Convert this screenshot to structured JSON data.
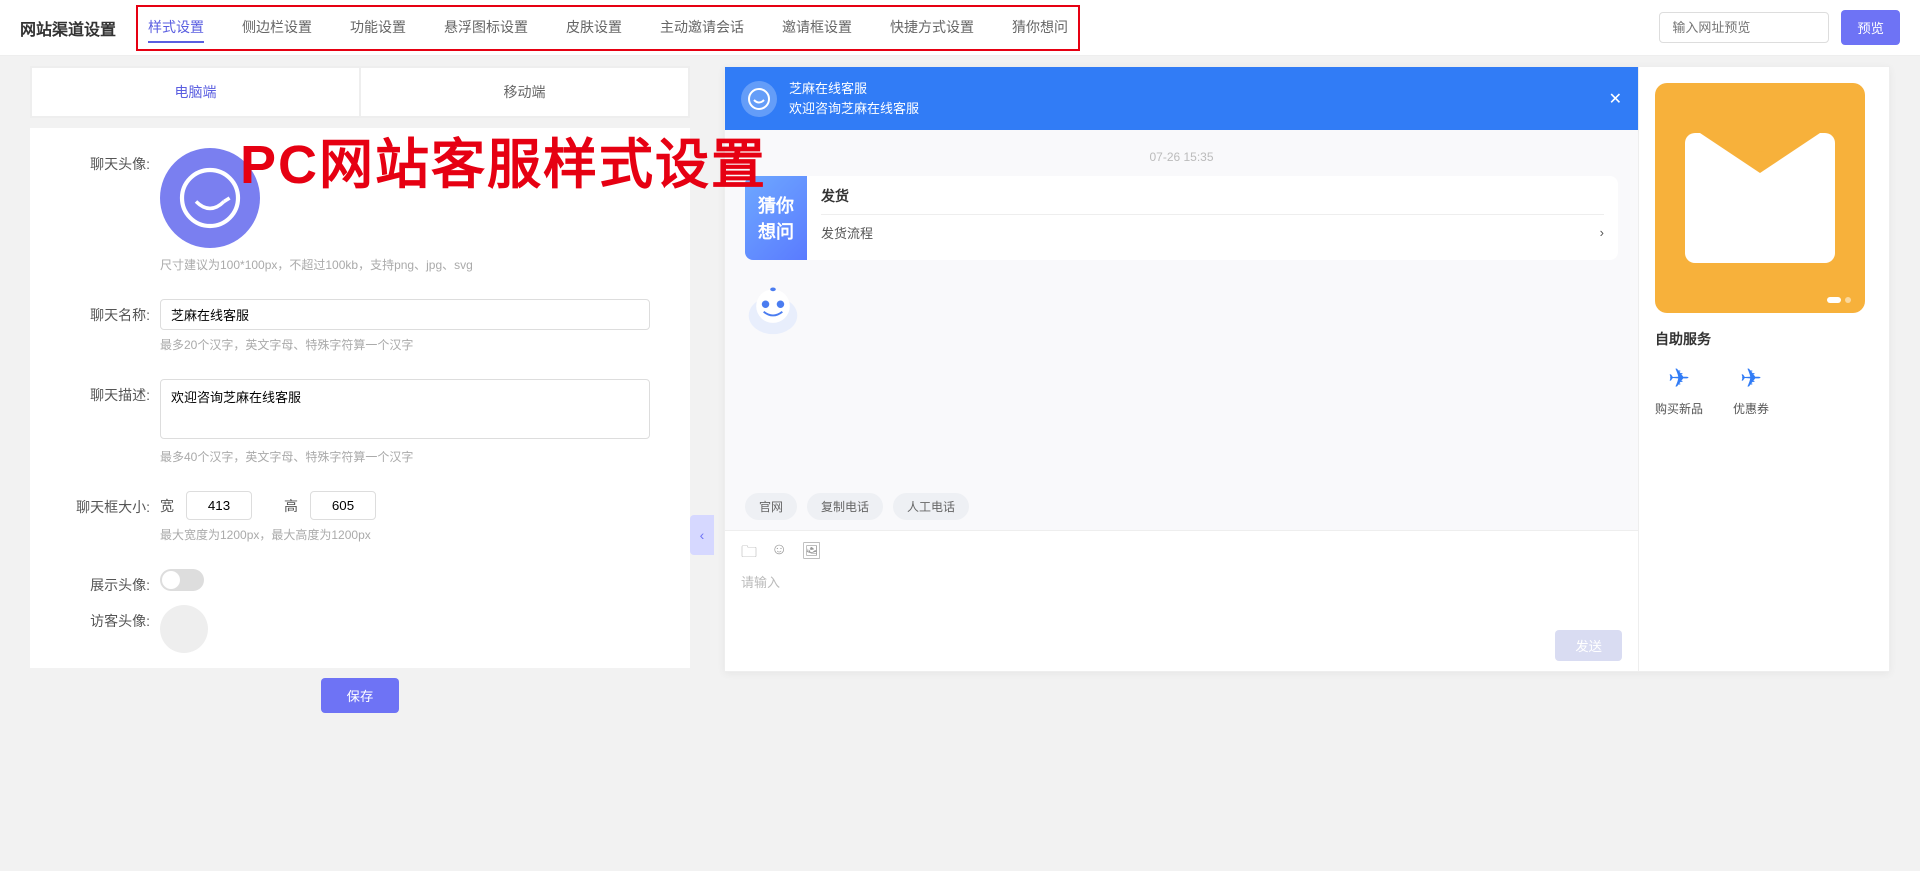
{
  "header": {
    "title": "网站渠道设置",
    "tabs": [
      "样式设置",
      "侧边栏设置",
      "功能设置",
      "悬浮图标设置",
      "皮肤设置",
      "主动邀请会话",
      "邀请框设置",
      "快捷方式设置",
      "猜你想问"
    ],
    "preview_placeholder": "输入网址预览",
    "preview_btn": "预览"
  },
  "device_tabs": {
    "pc": "电脑端",
    "mobile": "移动端"
  },
  "overlay": "PC网站客服样式设置",
  "form": {
    "avatar_label": "聊天头像:",
    "avatar_hint": "尺寸建议为100*100px，不超过100kb，支持png、jpg、svg",
    "name_label": "聊天名称:",
    "name_value": "芝麻在线客服",
    "name_hint": "最多20个汉字，英文字母、特殊字符算一个汉字",
    "desc_label": "聊天描述:",
    "desc_value": "欢迎咨询芝麻在线客服",
    "desc_hint": "最多40个汉字，英文字母、特殊字符算一个汉字",
    "size_label": "聊天框大小:",
    "width_label": "宽",
    "width_value": "413",
    "height_label": "高",
    "height_value": "605",
    "size_hint": "最大宽度为1200px，最大高度为1200px",
    "show_avatar_label": "展示头像:",
    "visitor_avatar_label": "访客头像:",
    "save_btn": "保存"
  },
  "chat": {
    "header_name": "芝麻在线客服",
    "header_desc": "欢迎咨询芝麻在线客服",
    "time": "07-26 15:35",
    "suggest_label": "猜你想问",
    "suggest_title": "发货",
    "suggest_item": "发货流程",
    "tags": [
      "官网",
      "复制电话",
      "人工电话"
    ],
    "input_placeholder": "请输入",
    "send_btn": "发送",
    "side_title": "自助服务",
    "services": [
      {
        "name": "购买新品",
        "icon": "plane"
      },
      {
        "name": "优惠券",
        "icon": "plane"
      }
    ]
  }
}
